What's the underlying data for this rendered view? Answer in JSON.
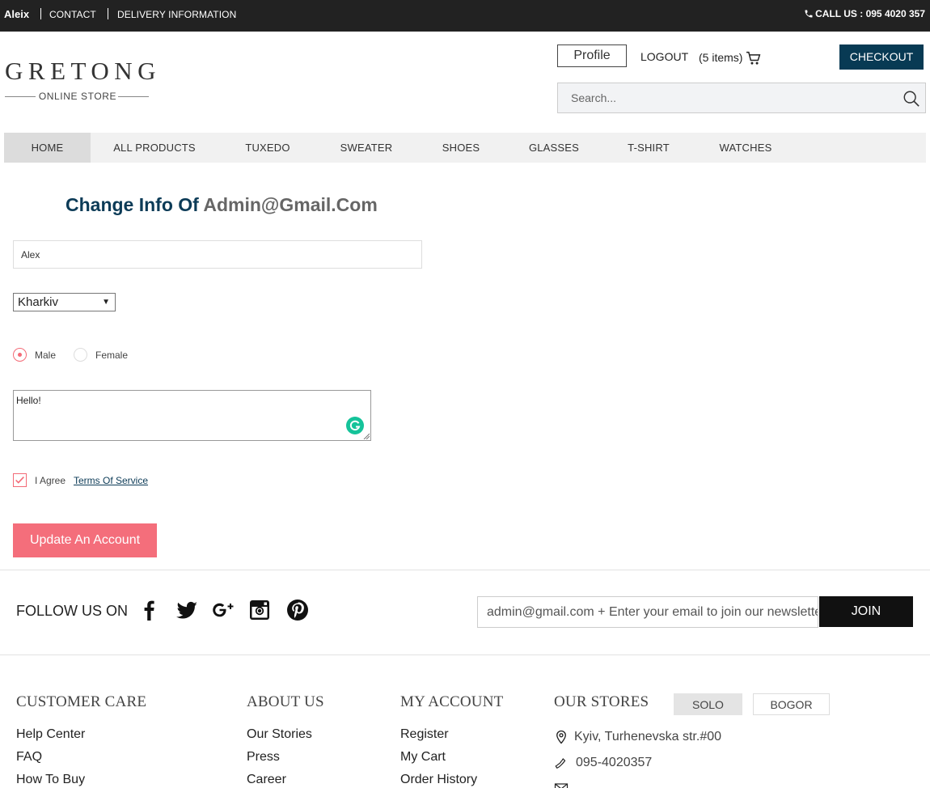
{
  "topbar": {
    "brand": "Aleix",
    "links": [
      "CONTACT",
      "DELIVERY INFORMATION"
    ],
    "call": "CALL US : 095 4020 357"
  },
  "header": {
    "logo_name": "GRETONG",
    "logo_sub": "ONLINE STORE",
    "profile": "Profile",
    "logout": "LOGOUT",
    "items": "(5 items)",
    "checkout": "CHECKOUT",
    "search_placeholder": "Search..."
  },
  "nav": {
    "items": [
      "HOME",
      "ALL PRODUCTS",
      "TUXEDO",
      "SWEATER",
      "SHOES",
      "GLASSES",
      "T-SHIRT",
      "WATCHES"
    ],
    "active": "HOME"
  },
  "form": {
    "title_prefix": "Change Info Of",
    "title_email": "Admin@Gmail.Com",
    "name_value": "Alex",
    "city_value": "Kharkiv",
    "gender_options": [
      "Male",
      "Female"
    ],
    "gender_selected": "Male",
    "message": "Hello!",
    "agree_label": "I Agree",
    "terms_label": "Terms Of Service",
    "agree_checked": true,
    "submit_label": "Update An Account"
  },
  "follow": {
    "label": "FOLLOW US ON",
    "icons": [
      "facebook-icon",
      "twitter-icon",
      "google-plus-icon",
      "instagram-icon",
      "pinterest-icon"
    ],
    "newsletter_value": "admin@gmail.com + Enter your email to join our newsletter",
    "join_label": "JOIN"
  },
  "footer": {
    "customer_care": {
      "heading": "CUSTOMER CARE",
      "links": [
        "Help Center",
        "FAQ",
        "How To Buy"
      ]
    },
    "about_us": {
      "heading": "ABOUT US",
      "links": [
        "Our Stories",
        "Press",
        "Career"
      ]
    },
    "my_account": {
      "heading": "MY ACCOUNT",
      "links": [
        "Register",
        "My Cart",
        "Order History"
      ]
    },
    "our_stores": {
      "heading": "OUR STORES",
      "tabs": [
        "SOLO",
        "BOGOR"
      ],
      "active_tab": "SOLO",
      "address": "Kyiv, Turhenevska str.#00",
      "phone": "095-4020357"
    }
  },
  "colors": {
    "topbar_bg": "#222222",
    "brand_navy": "#083A54",
    "accent_pink": "#F46E7B",
    "nav_bg": "#F1F1F1"
  }
}
